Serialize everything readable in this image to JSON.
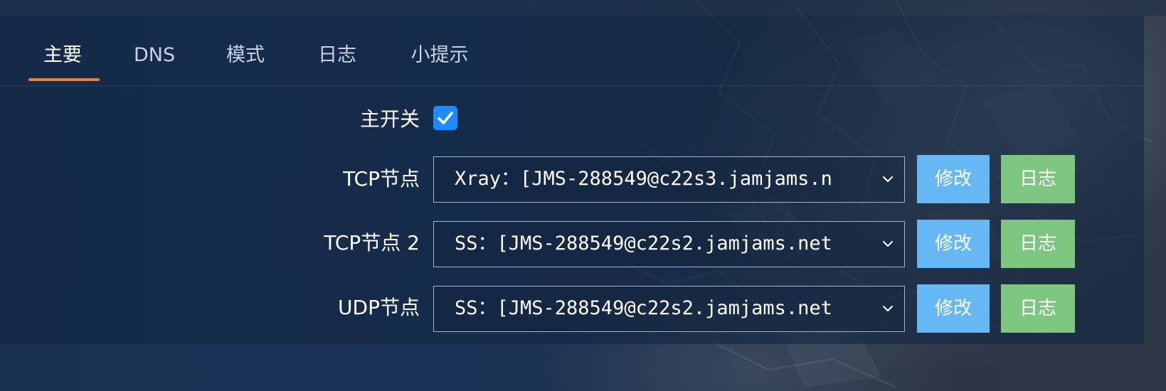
{
  "tabs": [
    {
      "label": "主要",
      "active": true
    },
    {
      "label": "DNS",
      "active": false
    },
    {
      "label": "模式",
      "active": false
    },
    {
      "label": "日志",
      "active": false
    },
    {
      "label": "小提示",
      "active": false
    }
  ],
  "form": {
    "master_switch": {
      "label": "主开关",
      "checked": true
    },
    "rows": [
      {
        "label": "TCP节点",
        "value": "Xray：[JMS-288549@c22s3.jamjams.n",
        "edit_label": "修改",
        "log_label": "日志"
      },
      {
        "label": "TCP节点 2",
        "value": "SS：[JMS-288549@c22s2.jamjams.net",
        "edit_label": "修改",
        "log_label": "日志"
      },
      {
        "label": "UDP节点",
        "value": "SS：[JMS-288549@c22s2.jamjams.net",
        "edit_label": "修改",
        "log_label": "日志"
      }
    ]
  },
  "colors": {
    "accent_tab": "#f07f3c",
    "checkbox": "#1a8cff",
    "edit_button": "#66b8f4",
    "log_button": "#7cc67f"
  },
  "icons": {
    "checkbox": "check-icon",
    "select": "chevron-down-icon"
  }
}
